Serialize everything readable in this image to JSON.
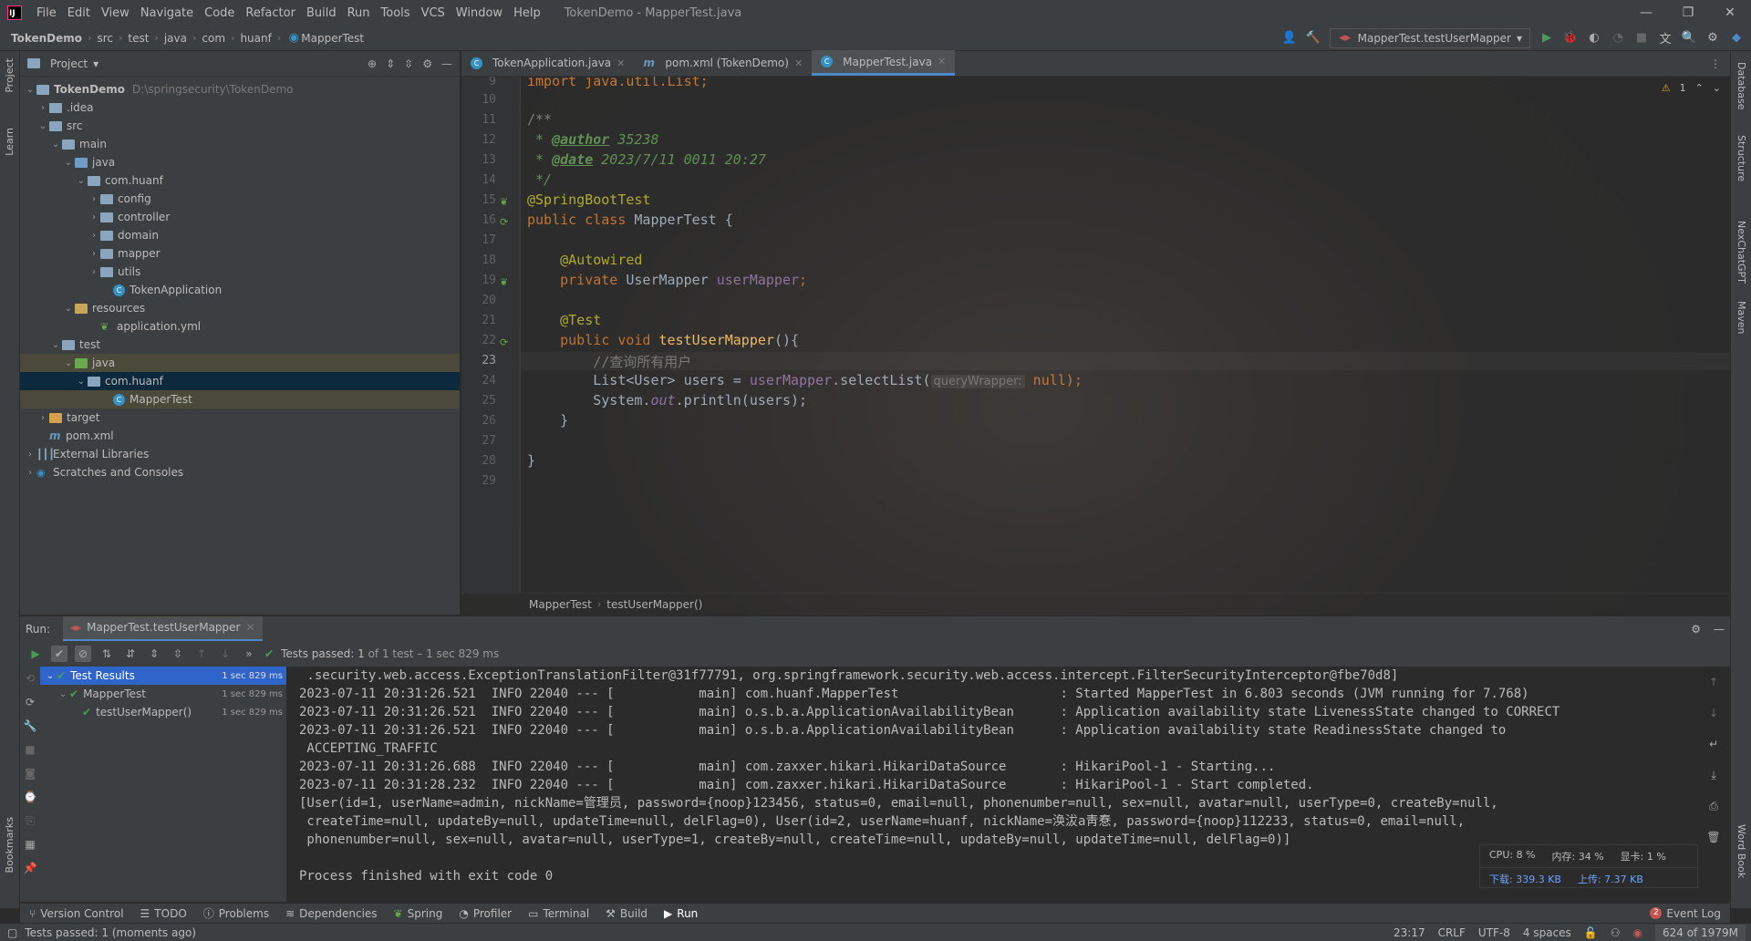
{
  "menu": [
    "File",
    "Edit",
    "View",
    "Navigate",
    "Code",
    "Refactor",
    "Build",
    "Run",
    "Tools",
    "VCS",
    "Window",
    "Help"
  ],
  "window_title": "TokenDemo - MapperTest.java",
  "breadcrumbs": [
    "TokenDemo",
    "src",
    "test",
    "java",
    "com",
    "huanf",
    "MapperTest"
  ],
  "run_config": "MapperTest.testUserMapper",
  "project": {
    "title": "Project",
    "tree": [
      {
        "name": "TokenDemo",
        "extra": "D:\\springsecurity\\TokenDemo"
      },
      {
        "name": ".idea"
      },
      {
        "name": "src"
      },
      {
        "name": "main"
      },
      {
        "name": "java"
      },
      {
        "name": "com.huanf"
      },
      {
        "name": "config"
      },
      {
        "name": "controller"
      },
      {
        "name": "domain"
      },
      {
        "name": "mapper"
      },
      {
        "name": "utils"
      },
      {
        "name": "TokenApplication"
      },
      {
        "name": "resources"
      },
      {
        "name": "application.yml"
      },
      {
        "name": "test"
      },
      {
        "name": "java"
      },
      {
        "name": "com.huanf"
      },
      {
        "name": "MapperTest"
      },
      {
        "name": "target"
      },
      {
        "name": "pom.xml"
      },
      {
        "name": "External Libraries"
      },
      {
        "name": "Scratches and Consoles"
      }
    ]
  },
  "editor_tabs": [
    {
      "label": "TokenApplication.java"
    },
    {
      "label": "pom.xml (TokenDemo)"
    },
    {
      "label": "MapperTest.java"
    }
  ],
  "line_numbers": [
    "9",
    "10",
    "11",
    "12",
    "13",
    "14",
    "15",
    "16",
    "17",
    "18",
    "19",
    "20",
    "21",
    "22",
    "23",
    "24",
    "25",
    "26",
    "27",
    "28",
    "29"
  ],
  "code": {
    "l9": "import java.util.List;",
    "l11": "/**",
    "l12_pre": " * ",
    "l12_tag": "@author",
    "l12_val": " 35238",
    "l13_pre": " * ",
    "l13_tag": "@date",
    "l13_val": " 2023/7/11 0011 20:27",
    "l14": " */",
    "l15": "@SpringBootTest",
    "l16_kw": "public class ",
    "l16_name": "MapperTest {",
    "l18": "    @Autowired",
    "l19_kw": "    private ",
    "l19_type": "UserMapper ",
    "l19_field": "userMapper",
    "l19_end": ";",
    "l21": "    @Test",
    "l22_kw": "    public void ",
    "l22_method": "testUserMapper",
    "l22_end": "(){",
    "l23": "        //查询所有用户",
    "l24_pre": "        List<User> users = ",
    "l24_field": "userMapper",
    "l24_call": ".selectList(",
    "l24_hint": "queryWrapper:",
    "l24_null": " null",
    "l24_end": ");",
    "l25_pre": "        System.",
    "l25_static": "out",
    "l25_end": ".println(users);",
    "l26": "    }",
    "l28": "}"
  },
  "warning_count": "1",
  "editor_breadcrumb": [
    "MapperTest",
    "testUserMapper()"
  ],
  "run": {
    "label": "Run:",
    "tab": "MapperTest.testUserMapper",
    "status_prefix": "Tests passed:",
    "status_count": "1",
    "status_suffix": "of 1 test – 1 sec 829 ms",
    "tests": [
      {
        "name": "Test Results",
        "time": "1 sec 829 ms"
      },
      {
        "name": "MapperTest",
        "time": "1 sec 829 ms"
      },
      {
        "name": "testUserMapper()",
        "time": "1 sec 829 ms"
      }
    ],
    "console": [
      " .security.web.access.ExceptionTranslationFilter@31f77791, org.springframework.security.web.access.intercept.FilterSecurityInterceptor@fbe70d8]",
      "2023-07-11 20:31:26.521  INFO 22040 --- [           main] com.huanf.MapperTest                     : Started MapperTest in 6.803 seconds (JVM running for 7.768)",
      "2023-07-11 20:31:26.521  INFO 22040 --- [           main] o.s.b.a.ApplicationAvailabilityBean      : Application availability state LivenessState changed to CORRECT",
      "2023-07-11 20:31:26.521  INFO 22040 --- [           main] o.s.b.a.ApplicationAvailabilityBean      : Application availability state ReadinessState changed to",
      " ACCEPTING_TRAFFIC",
      "2023-07-11 20:31:26.688  INFO 22040 --- [           main] com.zaxxer.hikari.HikariDataSource       : HikariPool-1 - Starting...",
      "2023-07-11 20:31:28.232  INFO 22040 --- [           main] com.zaxxer.hikari.HikariDataSource       : HikariPool-1 - Start completed.",
      "[User(id=1, userName=admin, nickName=管理员, password={noop}123456, status=0, email=null, phonenumber=null, sex=null, avatar=null, userType=0, createBy=null,",
      " createTime=null, updateBy=null, updateTime=null, delFlag=0), User(id=2, userName=huanf, nickName=涣沷a靑惷, password={noop}112233, status=0, email=null,",
      " phonenumber=null, sex=null, avatar=null, userType=1, createBy=null, createTime=null, updateBy=null, updateTime=null, delFlag=0)]",
      "",
      "Process finished with exit code 0"
    ]
  },
  "stats": {
    "cpu": "CPU: 8 %",
    "mem": "内存: 34 %",
    "gpu": "显卡: 1 %",
    "down": "下载: 339.3 KB",
    "up": "上传: 7.37 KB"
  },
  "bottom_tools": [
    "Version Control",
    "TODO",
    "Problems",
    "Dependencies",
    "Spring",
    "Profiler",
    "Terminal",
    "Build",
    "Run"
  ],
  "event_log": {
    "label": "Event Log",
    "count": "2"
  },
  "left_strip": [
    "Project",
    "Learn",
    "Bookmarks"
  ],
  "right_strip": [
    "Database",
    "Structure",
    "NexChatGPT",
    "Maven",
    "Word Book"
  ],
  "status": {
    "message": "Tests passed: 1 (moments ago)",
    "position": "23:17",
    "line_sep": "CRLF",
    "encoding": "UTF-8",
    "indent": "4 spaces",
    "memory": "624 of 1979M"
  }
}
